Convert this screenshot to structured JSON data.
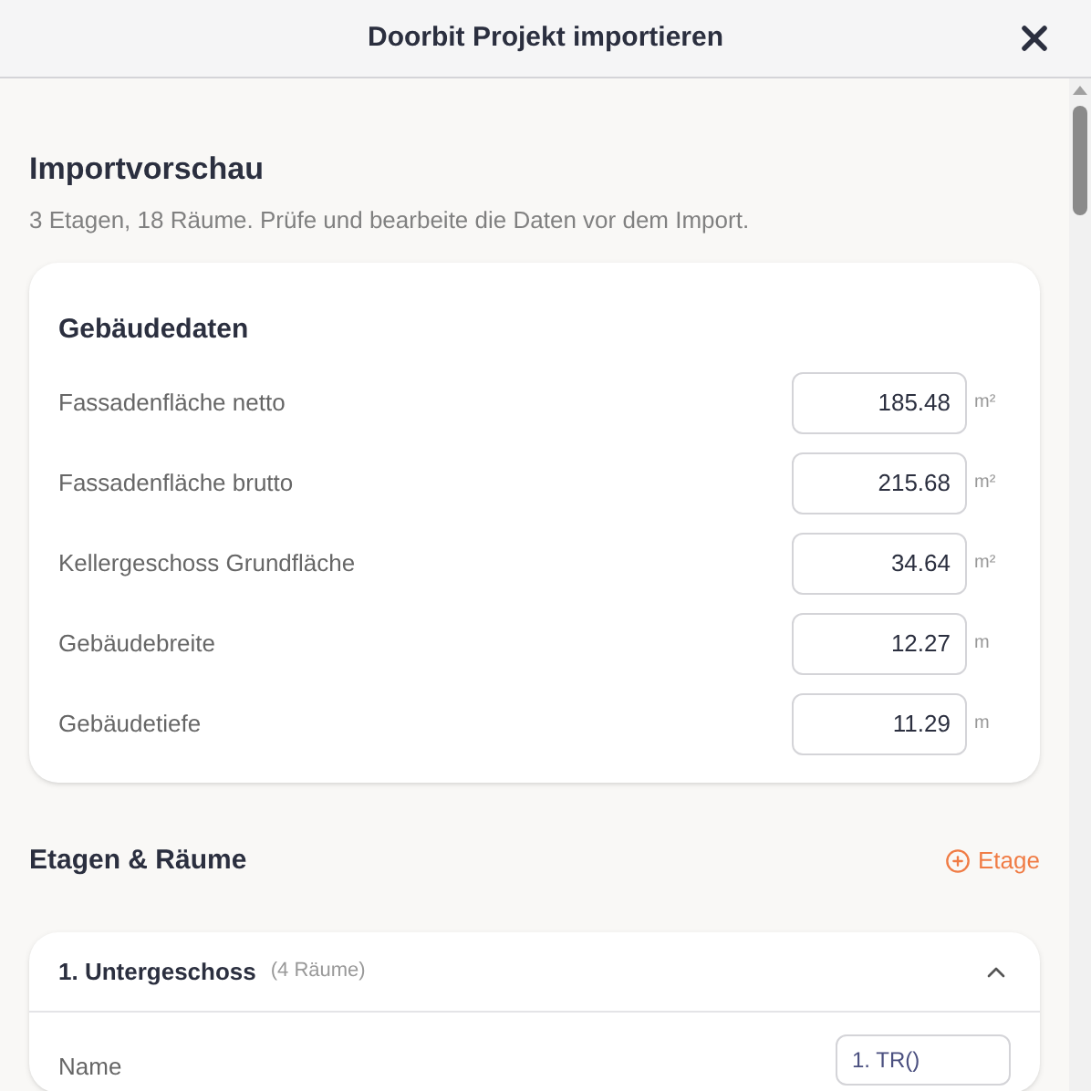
{
  "window": {
    "title": "Doorbit Projekt importieren"
  },
  "preview": {
    "title": "Importvorschau",
    "summary": "3 Etagen, 18 Räume. Prüfe und bearbeite die Daten vor dem Import."
  },
  "building": {
    "title": "Gebäudedaten",
    "fields": [
      {
        "label": "Fassadenfläche netto",
        "value": "185.48",
        "unit": "m²"
      },
      {
        "label": "Fassadenfläche brutto",
        "value": "215.68",
        "unit": "m²"
      },
      {
        "label": "Kellergeschoss Grundfläche",
        "value": "34.64",
        "unit": "m²"
      },
      {
        "label": "Gebäudebreite",
        "value": "12.27",
        "unit": "m"
      },
      {
        "label": "Gebäudetiefe",
        "value": "11.29",
        "unit": "m"
      }
    ]
  },
  "floors_section": {
    "title": "Etagen & Räume",
    "add_button": "Etage"
  },
  "floors": [
    {
      "name": "1. Untergeschoss",
      "count": "(4 Räume)",
      "expanded": true,
      "fields": [
        {
          "label": "Name",
          "value": "1. TR()"
        }
      ]
    }
  ]
}
